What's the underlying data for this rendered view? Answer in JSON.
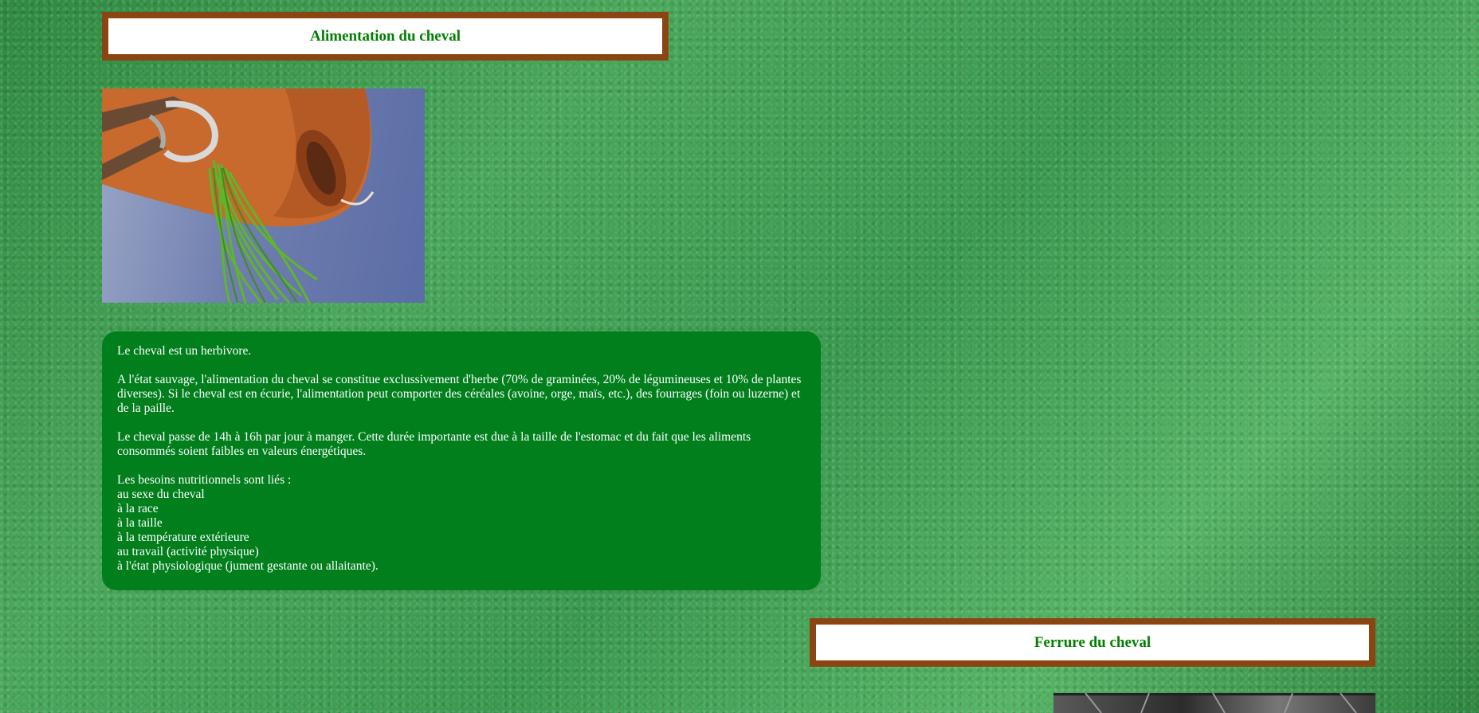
{
  "sections": [
    {
      "title": "Alimentation du cheval",
      "paragraphs": [
        "Le cheval est un herbivore.",
        "A l'état sauvage, l'alimentation du cheval se constitue exclussivement d'herbe (70% de graminées, 20% de légumineuses et 10% de plantes diverses). Si le cheval est en écurie, l'alimentation peut comporter des céréales (avoine, orge, maïs, etc.), des fourrages (foin ou luzerne) et de la paille.",
        "Le cheval passe de 14h à 16h par jour à manger. Cette durée importante est due à la taille de l'estomac et du fait que les aliments consommés soient faibles en valeurs énergétiques."
      ],
      "needs_intro": "Les besoins nutritionnels sont liés :",
      "needs": [
        "au sexe du cheval",
        "à la race",
        "à la taille",
        "à la température extérieure",
        "au travail (activité physique)",
        "à l'état physiologique (jument gestante ou allaitante)."
      ]
    },
    {
      "title": "Ferrure du cheval"
    }
  ],
  "colors": {
    "frame": "#8b4513",
    "title_text": "#008000",
    "panel": "#007f1c",
    "background": "#3c9a4c"
  }
}
